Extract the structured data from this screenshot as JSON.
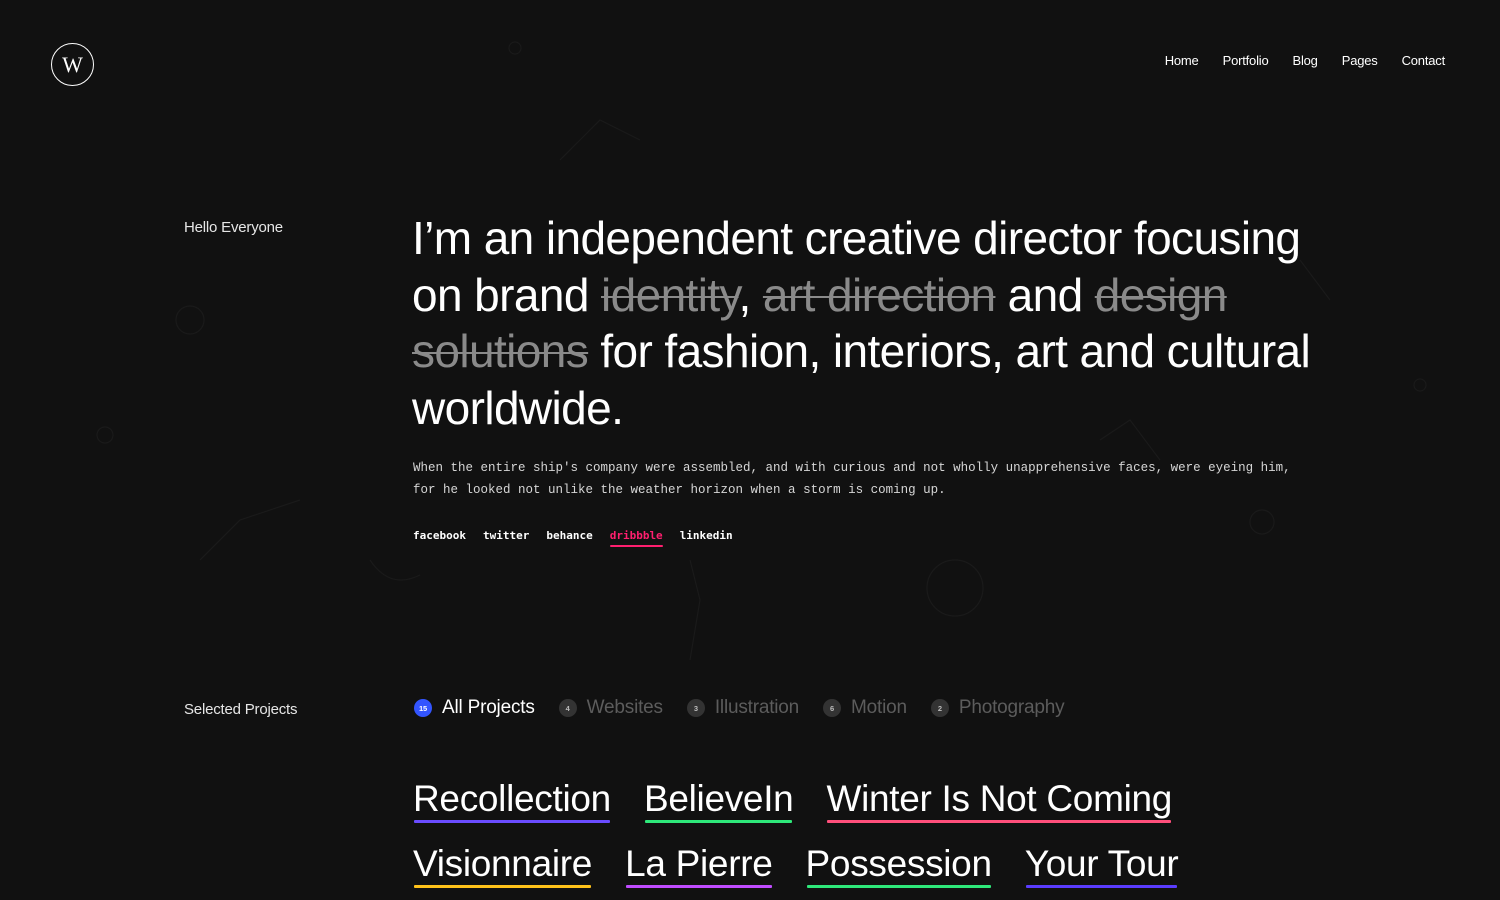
{
  "header": {
    "logo_letter": "W",
    "nav": [
      "Home",
      "Portfolio",
      "Blog",
      "Pages",
      "Contact"
    ]
  },
  "intro": {
    "label": "Hello Everyone",
    "headline": {
      "part1": "I’m an independent creative director focusing on brand ",
      "struck1": "identity",
      "part2": ", ",
      "struck2": "art direction",
      "part3": " and ",
      "struck3": "design solutions",
      "part4": " for fashion, interiors, art and cultural worldwide."
    },
    "bio": "When the entire ship's company were assembled, and with curious and not wholly unapprehensive faces, were eyeing him, for he looked not unlike the weather horizon when a storm is coming up.",
    "social": [
      {
        "label": "facebook",
        "active": false
      },
      {
        "label": "twitter",
        "active": false
      },
      {
        "label": "behance",
        "active": false
      },
      {
        "label": "dribbble",
        "active": true
      },
      {
        "label": "linkedin",
        "active": false
      }
    ]
  },
  "projects_section": {
    "label": "Selected Projects",
    "filters": [
      {
        "label": "All Projects",
        "count": "15",
        "active": true
      },
      {
        "label": "Websites",
        "count": "4",
        "active": false
      },
      {
        "label": "Illustration",
        "count": "3",
        "active": false
      },
      {
        "label": "Motion",
        "count": "6",
        "active": false
      },
      {
        "label": "Photography",
        "count": "2",
        "active": false
      }
    ],
    "projects": [
      {
        "title": "Recollection",
        "color": "#6a4cff"
      },
      {
        "title": "BelieveIn",
        "color": "#2ee87a"
      },
      {
        "title": "Winter Is Not Coming",
        "color": "#ff4f7b"
      },
      {
        "title": "Visionnaire",
        "color": "#ffc21a"
      },
      {
        "title": "La Pierre",
        "color": "#c04cff"
      },
      {
        "title": "Possession",
        "color": "#2ee87a"
      },
      {
        "title": "Your Tour",
        "color": "#5a3cff"
      }
    ]
  },
  "colors": {
    "background": "#111111",
    "accent_social": "#ff1f6f",
    "accent_filter": "#3355ff"
  }
}
